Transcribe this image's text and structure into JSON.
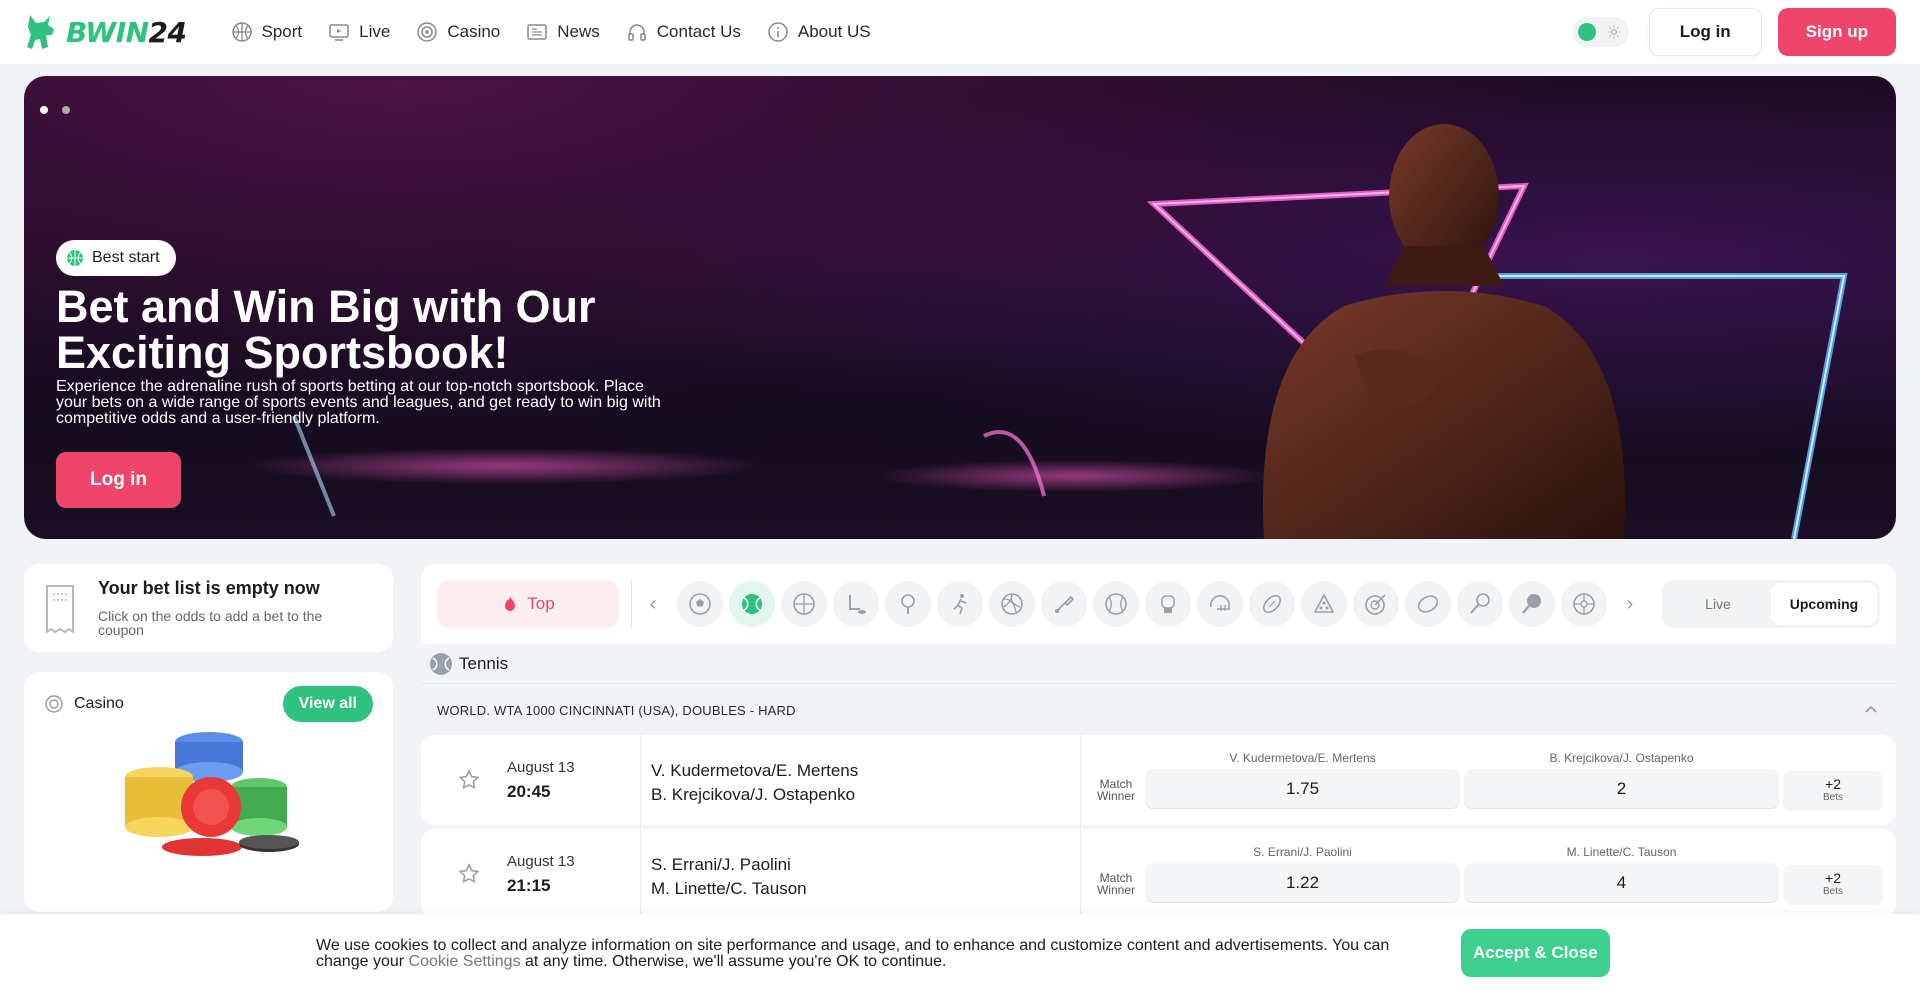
{
  "brand": {
    "name_part1": "BWIN",
    "name_part2": "24",
    "accent": "#2ec27e",
    "primary": "#f0456a"
  },
  "nav": [
    {
      "label": "Sport",
      "icon": "basketball-icon"
    },
    {
      "label": "Live",
      "icon": "tv-icon"
    },
    {
      "label": "Casino",
      "icon": "chip-icon"
    },
    {
      "label": "News",
      "icon": "newspaper-icon"
    },
    {
      "label": "Contact Us",
      "icon": "headset-icon"
    },
    {
      "label": "About US",
      "icon": "info-icon"
    }
  ],
  "header": {
    "login": "Log in",
    "signup": "Sign up"
  },
  "hero": {
    "badge": "Best start",
    "title": "Bet and Win Big with Our Exciting Sportsbook!",
    "description": "Experience the adrenaline rush of sports betting at our top-notch sportsbook. Place your bets on a wide range of sports events and leagues, and get ready to win big with competitive odds and a user-friendly platform.",
    "button": "Log in"
  },
  "betlist": {
    "title": "Your bet list is empty now",
    "subtitle": "Click on the odds to add a bet to the coupon"
  },
  "casino": {
    "label": "Casino",
    "view_all": "View all"
  },
  "sportsbar": {
    "top": "Top",
    "live": "Live",
    "upcoming": "Upcoming",
    "sports": [
      "soccer-icon",
      "tennis-icon",
      "basketball-icon",
      "ice-hockey-icon",
      "table-tennis-icon",
      "athletics-icon",
      "volleyball-icon",
      "badminton-icon",
      "baseball-icon",
      "boxing-icon",
      "american-football-helmet-icon",
      "rugby-icon",
      "snooker-icon",
      "darts-icon",
      "aussie-rules-icon",
      "squash-icon",
      "padel-icon",
      "futsal-icon"
    ]
  },
  "sport_title": "Tennis",
  "league": "WORLD. WTA 1000 CINCINNATI (USA), DOUBLES - HARD",
  "match_label": "Match Winner",
  "matches": [
    {
      "date": "August 13",
      "time": "20:45",
      "team1": "V. Kudermetova/E. Mertens",
      "team2": "B. Krejcikova/J. Ostapenko",
      "odd1": "1.75",
      "odd2": "2",
      "more": "+2",
      "more_label": "Bets"
    },
    {
      "date": "August 13",
      "time": "21:15",
      "team1": "S. Errani/J. Paolini",
      "team2": "M. Linette/C. Tauson",
      "odd1": "1.22",
      "odd2": "4",
      "more": "+2",
      "more_label": "Bets"
    }
  ],
  "cookie": {
    "text_before": "We use cookies to collect and analyze information on site performance and usage, and to enhance and customize content and advertisements. You can change your ",
    "link": "Cookie Settings",
    "text_after": " at any time. Otherwise, we'll assume you're OK to continue.",
    "button": "Accept & Close"
  }
}
